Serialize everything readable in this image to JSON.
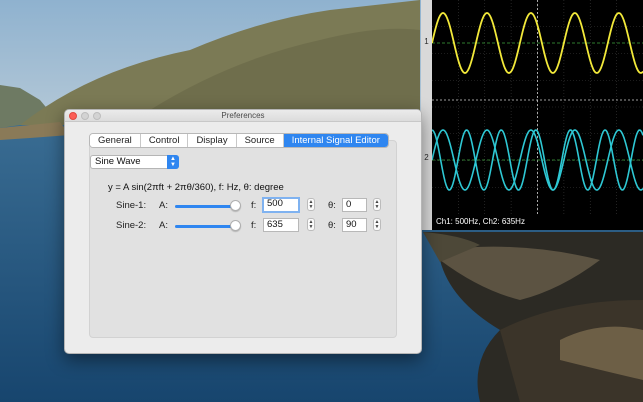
{
  "window": {
    "title": "Preferences"
  },
  "tabs": [
    {
      "label": "General",
      "active": false
    },
    {
      "label": "Control",
      "active": false
    },
    {
      "label": "Display",
      "active": false
    },
    {
      "label": "Source",
      "active": false
    },
    {
      "label": "Internal Signal Editor",
      "active": true
    }
  ],
  "waveform": {
    "selected": "Sine Wave"
  },
  "formula": "y = A sin(2πft + 2πθ/360),  f: Hz, θ: degree",
  "sine1": {
    "label": "Sine-1:",
    "amp_label": "A:",
    "amplitude_level": 0.97,
    "f_label": "f:",
    "frequency": "500",
    "theta_label": "θ:",
    "phase": "0"
  },
  "sine2": {
    "label": "Sine-2:",
    "amp_label": "A:",
    "amplitude_level": 0.97,
    "f_label": "f:",
    "frequency": "635",
    "theta_label": "θ:",
    "phase": "90"
  },
  "scope": {
    "ch1_marker": "1",
    "ch2_marker": "2",
    "status": "Ch1: 500Hz, Ch2: 635Hz",
    "colors": {
      "ch1": "#f2e93a",
      "ch2": "#2ec8d4",
      "grid": "#3a3a3a",
      "center_line": "#3ea33e"
    }
  },
  "colors": {
    "accent": "#2f86f0"
  }
}
